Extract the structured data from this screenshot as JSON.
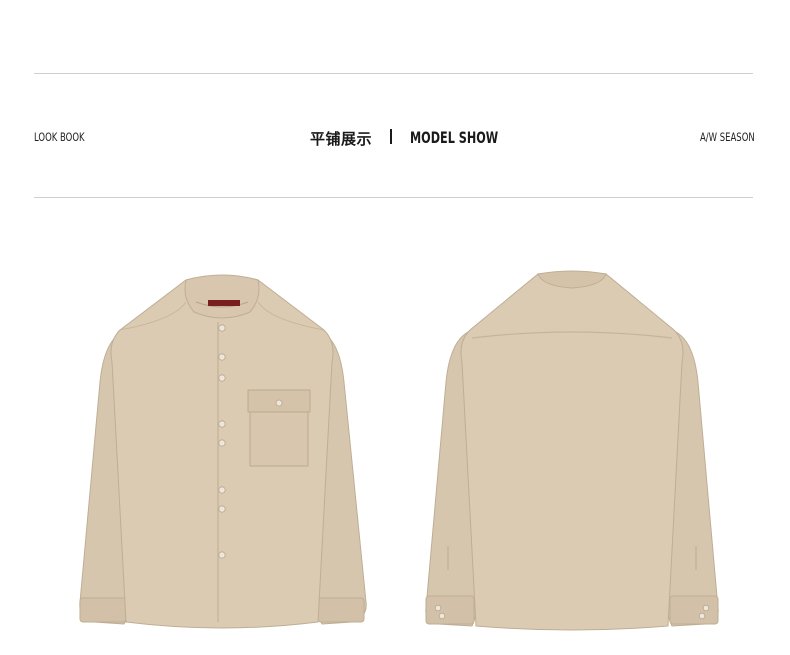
{
  "header": {
    "left_label": "LOOK BOOK",
    "title_cn": "平铺展示",
    "title_en": "MODEL SHOW",
    "right_label": "A/W SEASON"
  },
  "products": {
    "front_view": {
      "icon": "shirt-front-icon",
      "color": "#d9c9b2"
    },
    "back_view": {
      "icon": "shirt-back-icon",
      "color": "#d9c9b2"
    }
  },
  "colors": {
    "rule": "#cfcfcf",
    "text": "#1a1a1a",
    "fabric": "#d9c9b2",
    "fabric_shade": "#c9b79e"
  }
}
